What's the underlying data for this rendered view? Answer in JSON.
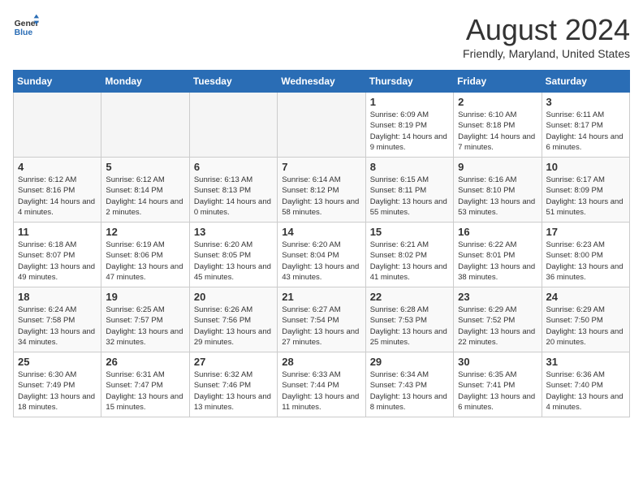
{
  "header": {
    "logo_line1": "General",
    "logo_line2": "Blue",
    "month_year": "August 2024",
    "location": "Friendly, Maryland, United States"
  },
  "weekdays": [
    "Sunday",
    "Monday",
    "Tuesday",
    "Wednesday",
    "Thursday",
    "Friday",
    "Saturday"
  ],
  "weeks": [
    [
      {
        "day": "",
        "empty": true
      },
      {
        "day": "",
        "empty": true
      },
      {
        "day": "",
        "empty": true
      },
      {
        "day": "",
        "empty": true
      },
      {
        "day": "1",
        "sunrise": "6:09 AM",
        "sunset": "8:19 PM",
        "daylight": "14 hours and 9 minutes."
      },
      {
        "day": "2",
        "sunrise": "6:10 AM",
        "sunset": "8:18 PM",
        "daylight": "14 hours and 7 minutes."
      },
      {
        "day": "3",
        "sunrise": "6:11 AM",
        "sunset": "8:17 PM",
        "daylight": "14 hours and 6 minutes."
      }
    ],
    [
      {
        "day": "4",
        "sunrise": "6:12 AM",
        "sunset": "8:16 PM",
        "daylight": "14 hours and 4 minutes."
      },
      {
        "day": "5",
        "sunrise": "6:12 AM",
        "sunset": "8:14 PM",
        "daylight": "14 hours and 2 minutes."
      },
      {
        "day": "6",
        "sunrise": "6:13 AM",
        "sunset": "8:13 PM",
        "daylight": "14 hours and 0 minutes."
      },
      {
        "day": "7",
        "sunrise": "6:14 AM",
        "sunset": "8:12 PM",
        "daylight": "13 hours and 58 minutes."
      },
      {
        "day": "8",
        "sunrise": "6:15 AM",
        "sunset": "8:11 PM",
        "daylight": "13 hours and 55 minutes."
      },
      {
        "day": "9",
        "sunrise": "6:16 AM",
        "sunset": "8:10 PM",
        "daylight": "13 hours and 53 minutes."
      },
      {
        "day": "10",
        "sunrise": "6:17 AM",
        "sunset": "8:09 PM",
        "daylight": "13 hours and 51 minutes."
      }
    ],
    [
      {
        "day": "11",
        "sunrise": "6:18 AM",
        "sunset": "8:07 PM",
        "daylight": "13 hours and 49 minutes."
      },
      {
        "day": "12",
        "sunrise": "6:19 AM",
        "sunset": "8:06 PM",
        "daylight": "13 hours and 47 minutes."
      },
      {
        "day": "13",
        "sunrise": "6:20 AM",
        "sunset": "8:05 PM",
        "daylight": "13 hours and 45 minutes."
      },
      {
        "day": "14",
        "sunrise": "6:20 AM",
        "sunset": "8:04 PM",
        "daylight": "13 hours and 43 minutes."
      },
      {
        "day": "15",
        "sunrise": "6:21 AM",
        "sunset": "8:02 PM",
        "daylight": "13 hours and 41 minutes."
      },
      {
        "day": "16",
        "sunrise": "6:22 AM",
        "sunset": "8:01 PM",
        "daylight": "13 hours and 38 minutes."
      },
      {
        "day": "17",
        "sunrise": "6:23 AM",
        "sunset": "8:00 PM",
        "daylight": "13 hours and 36 minutes."
      }
    ],
    [
      {
        "day": "18",
        "sunrise": "6:24 AM",
        "sunset": "7:58 PM",
        "daylight": "13 hours and 34 minutes."
      },
      {
        "day": "19",
        "sunrise": "6:25 AM",
        "sunset": "7:57 PM",
        "daylight": "13 hours and 32 minutes."
      },
      {
        "day": "20",
        "sunrise": "6:26 AM",
        "sunset": "7:56 PM",
        "daylight": "13 hours and 29 minutes."
      },
      {
        "day": "21",
        "sunrise": "6:27 AM",
        "sunset": "7:54 PM",
        "daylight": "13 hours and 27 minutes."
      },
      {
        "day": "22",
        "sunrise": "6:28 AM",
        "sunset": "7:53 PM",
        "daylight": "13 hours and 25 minutes."
      },
      {
        "day": "23",
        "sunrise": "6:29 AM",
        "sunset": "7:52 PM",
        "daylight": "13 hours and 22 minutes."
      },
      {
        "day": "24",
        "sunrise": "6:29 AM",
        "sunset": "7:50 PM",
        "daylight": "13 hours and 20 minutes."
      }
    ],
    [
      {
        "day": "25",
        "sunrise": "6:30 AM",
        "sunset": "7:49 PM",
        "daylight": "13 hours and 18 minutes."
      },
      {
        "day": "26",
        "sunrise": "6:31 AM",
        "sunset": "7:47 PM",
        "daylight": "13 hours and 15 minutes."
      },
      {
        "day": "27",
        "sunrise": "6:32 AM",
        "sunset": "7:46 PM",
        "daylight": "13 hours and 13 minutes."
      },
      {
        "day": "28",
        "sunrise": "6:33 AM",
        "sunset": "7:44 PM",
        "daylight": "13 hours and 11 minutes."
      },
      {
        "day": "29",
        "sunrise": "6:34 AM",
        "sunset": "7:43 PM",
        "daylight": "13 hours and 8 minutes."
      },
      {
        "day": "30",
        "sunrise": "6:35 AM",
        "sunset": "7:41 PM",
        "daylight": "13 hours and 6 minutes."
      },
      {
        "day": "31",
        "sunrise": "6:36 AM",
        "sunset": "7:40 PM",
        "daylight": "13 hours and 4 minutes."
      }
    ]
  ]
}
